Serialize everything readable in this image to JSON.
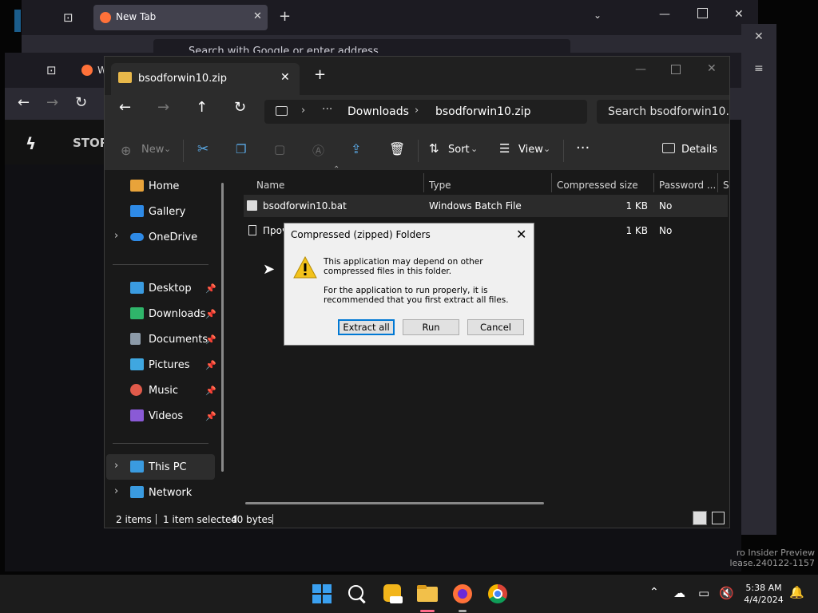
{
  "background_browser": {
    "tab_title": "New Tab",
    "address_placeholder": "Search with Google or enter address",
    "second_tab_fragment": "W",
    "store_label": "STOR",
    "left_fragment": "Ti"
  },
  "watermark": {
    "line1": "ro Insider Preview",
    "line2": "lease.240122-1157"
  },
  "explorer": {
    "tab_title": "bsodforwin10.zip",
    "breadcrumb": [
      "Downloads",
      "bsodforwin10.zip"
    ],
    "search_placeholder": "Search bsodforwin10.zip",
    "commands": {
      "new": "New",
      "sort": "Sort",
      "view": "View",
      "details": "Details"
    },
    "sidebar": {
      "top": [
        {
          "label": "Home",
          "icon": "home-icon",
          "color": "#e8a33a"
        },
        {
          "label": "Gallery",
          "icon": "gallery-icon",
          "color": "#2e8ae6"
        },
        {
          "label": "OneDrive",
          "icon": "cloud-icon",
          "color": "#2e8ae6"
        }
      ],
      "quick": [
        {
          "label": "Desktop",
          "icon": "desktop-icon",
          "color": "#3a9be0"
        },
        {
          "label": "Downloads",
          "icon": "download-icon",
          "color": "#2fb56a"
        },
        {
          "label": "Documents",
          "icon": "document-icon",
          "color": "#8c9aa8"
        },
        {
          "label": "Pictures",
          "icon": "pictures-icon",
          "color": "#3fa7e0"
        },
        {
          "label": "Music",
          "icon": "music-icon",
          "color": "#e05a4a"
        },
        {
          "label": "Videos",
          "icon": "videos-icon",
          "color": "#8a5ad6"
        }
      ],
      "bottom": [
        {
          "label": "This PC",
          "icon": "pc-icon",
          "color": "#3a9be0"
        },
        {
          "label": "Network",
          "icon": "network-icon",
          "color": "#3a9be0"
        }
      ]
    },
    "columns": [
      "Name",
      "Type",
      "Compressed size",
      "Password ...",
      "Si"
    ],
    "rows": [
      {
        "name": "bsodforwin10.bat",
        "type": "Windows Batch File",
        "size": "1 KB",
        "password": "No"
      },
      {
        "name": "Проч",
        "type": "",
        "size": "1 KB",
        "password": "No"
      }
    ],
    "status": {
      "items": "2 items",
      "selected": "1 item selected",
      "bytes": "40 bytes"
    }
  },
  "dialog": {
    "title": "Compressed (zipped) Folders",
    "message1": "This application may depend on other compressed files in this folder.",
    "message2": "For the application to run properly, it is recommended that you first extract all files.",
    "buttons": {
      "extract": "Extract all",
      "run": "Run",
      "cancel": "Cancel"
    }
  },
  "taskbar": {
    "time": "5:38 AM",
    "date": "4/4/2024"
  }
}
